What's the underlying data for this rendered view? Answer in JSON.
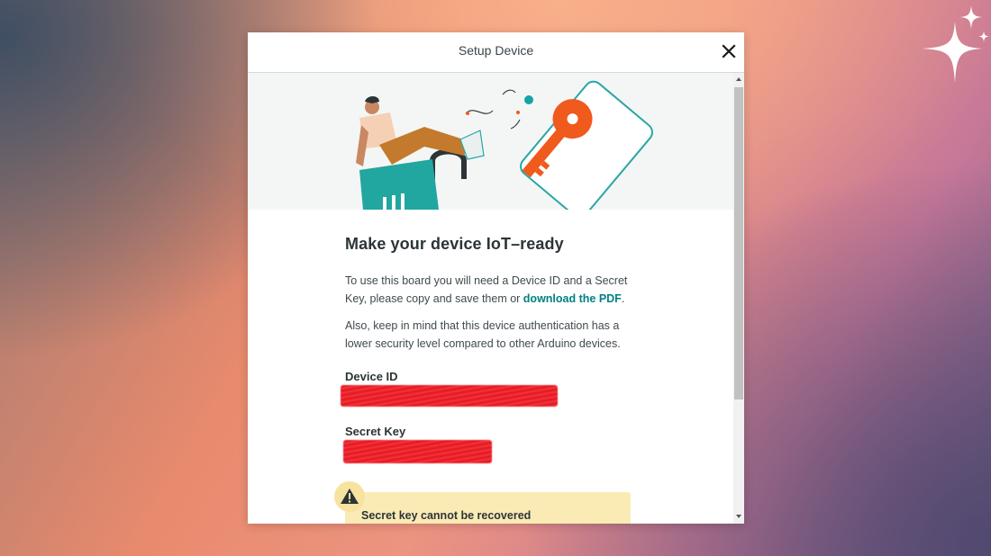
{
  "modal": {
    "title": "Setup Device",
    "close_icon": "close-icon"
  },
  "content": {
    "heading": "Make your device IoT–ready",
    "para1_text": "To use this board you will need a Device ID and a Secret Key, please copy and save them or ",
    "para1_link": "download the PDF",
    "para1_end": ".",
    "para2": "Also, keep in mind that this device authentication has a lower security level compared to other Arduino devices.",
    "device_id_label": "Device ID",
    "secret_key_label": "Secret Key",
    "warning_text": "Secret key cannot be recovered",
    "warning_icon": "warning-icon"
  },
  "colors": {
    "accent": "#008184",
    "redaction": "#e81a24",
    "warning_bg": "#faebb5"
  }
}
